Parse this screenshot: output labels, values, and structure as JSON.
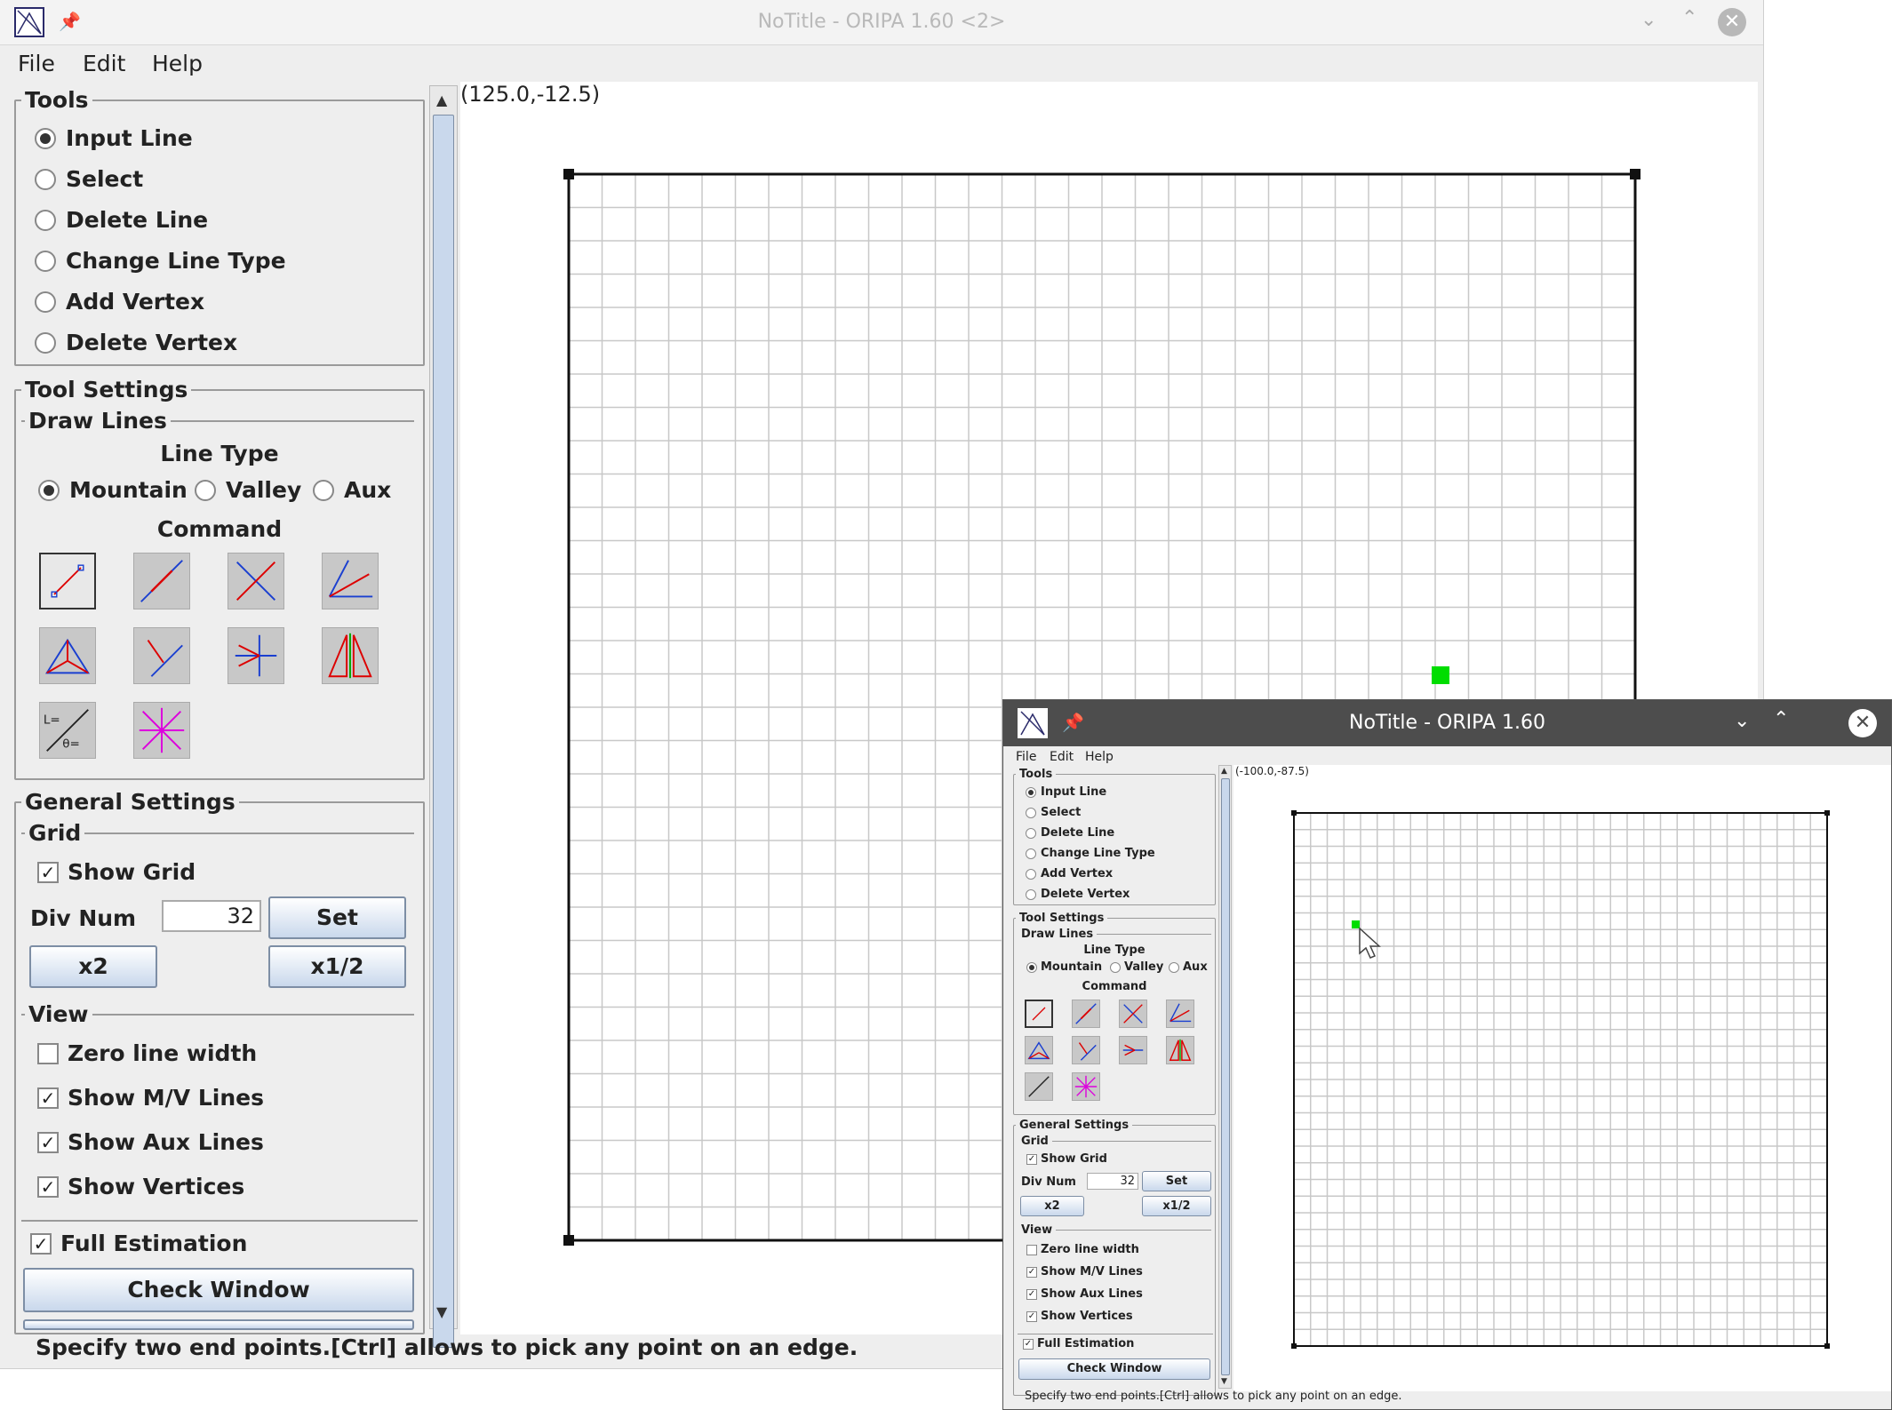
{
  "main_window": {
    "title": "NoTitle - ORIPA 1.60 <2>",
    "menu": [
      "File",
      "Edit",
      "Help"
    ],
    "tools": {
      "legend": "Tools",
      "items": [
        "Input Line",
        "Select",
        "Delete Line",
        "Change Line Type",
        "Add Vertex",
        "Delete Vertex"
      ],
      "selected": "Input Line"
    },
    "tool_settings": {
      "legend": "Tool Settings",
      "draw_lines": "Draw Lines",
      "line_type_label": "Line Type",
      "line_types": [
        "Mountain",
        "Valley",
        "Aux"
      ],
      "selected_line_type": "Mountain",
      "command_label": "Command",
      "commands": [
        "two-point-line-icon",
        "segment-on-line-icon",
        "perpendicular-bisector-icon",
        "angle-bisector-icon",
        "incenter-icon",
        "perpendicular-icon",
        "symmetric-line-icon",
        "mirror-copy-icon",
        "length-angle-icon",
        "radial-lines-icon"
      ]
    },
    "general_settings": {
      "legend": "General Settings",
      "grid_label": "Grid",
      "show_grid": "Show Grid",
      "div_num_label": "Div Num",
      "div_num_value": "32",
      "set_button": "Set",
      "x2_button": "x2",
      "half_button": "x1/2",
      "view_label": "View",
      "view_options": [
        {
          "label": "Zero line width",
          "checked": false
        },
        {
          "label": "Show M/V Lines",
          "checked": true
        },
        {
          "label": "Show Aux Lines",
          "checked": true
        },
        {
          "label": "Show Vertices",
          "checked": true
        }
      ],
      "full_estimation": "Full Estimation",
      "check_window": "Check Window"
    },
    "coords": "(125.0,-12.5)",
    "status": "Specify two end points.[Ctrl] allows to pick any point on an edge."
  },
  "small_window": {
    "title": "NoTitle - ORIPA 1.60",
    "coords": "(-100.0,-87.5)"
  },
  "colors": {
    "accent_green": "#00dd00",
    "mountain_red": "#dd0000",
    "valley_blue": "#1a3fd0",
    "aux_magenta": "#dd00dd",
    "grid_gray": "#c8c8c8"
  }
}
